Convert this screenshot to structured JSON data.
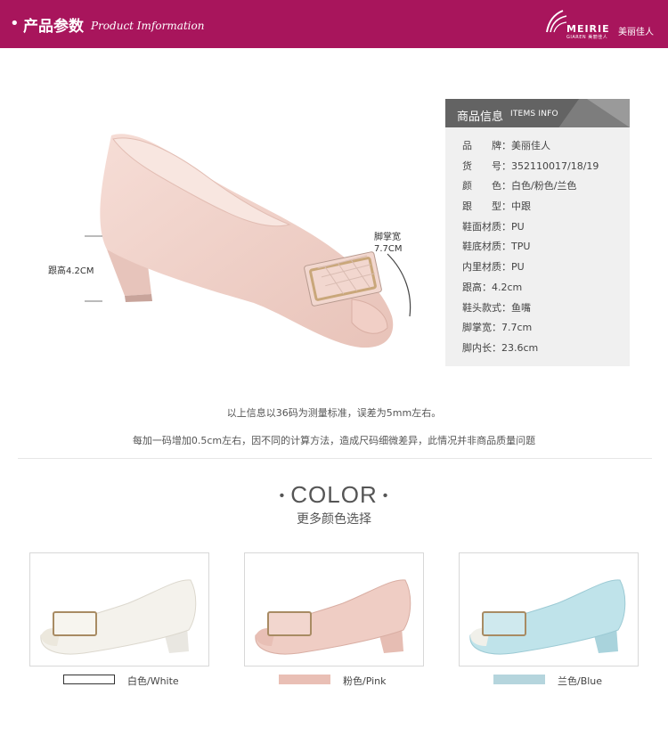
{
  "header": {
    "title_cn": "产品参数",
    "title_en": "Product Imformation",
    "brand_logo_en": "MEIRIE",
    "brand_logo_sub": "GIAREN 美丽佳人",
    "brand_cn": "美丽佳人",
    "bg_color": "#a8155c"
  },
  "measurements": {
    "heel_label": "跟高4.2CM",
    "width_label_cn": "脚掌宽",
    "width_label_val": "7.7CM"
  },
  "info": {
    "title_cn": "商品信息",
    "title_en": "ITEMS INFO",
    "rows": [
      "品　　牌：美丽佳人",
      "货　　号：352110017/18/19",
      "颜　　色：白色/粉色/兰色",
      "跟　　型：中跟",
      "鞋面材质：PU",
      "鞋底材质：TPU",
      "内里材质：PU",
      "跟高：4.2cm",
      "鞋头款式：鱼嘴",
      "脚掌宽：7.7cm",
      "脚内长：23.6cm"
    ]
  },
  "notes": {
    "line1": "以上信息以36码为测量标准，误差为5mm左右。",
    "line2": "每加一码增加0.5cm左右，因不同的计算方法，造成尺码细微差异，此情况并非商品质量问题"
  },
  "colors": {
    "title": "COLOR",
    "subtitle": "更多颜色选择",
    "options": [
      {
        "label": "白色/White",
        "swatch": "#ffffff",
        "shoe": "#f4f2ec"
      },
      {
        "label": "粉色/Pink",
        "swatch": "#e9bfb5",
        "shoe": "#efcdc4"
      },
      {
        "label": "兰色/Blue",
        "swatch": "#b5d5dd",
        "shoe": "#bfe3ea"
      }
    ]
  }
}
